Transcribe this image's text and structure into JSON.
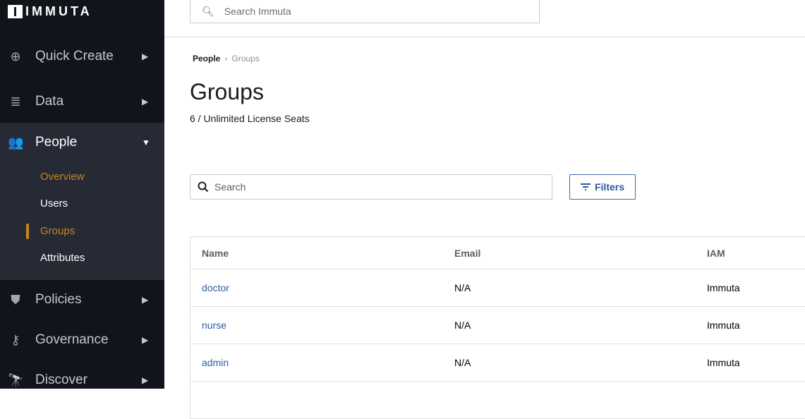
{
  "brand": "IMMUTA",
  "sidebar": {
    "items": [
      {
        "label": "Quick Create",
        "icon": "plus-circle-icon"
      },
      {
        "label": "Data",
        "icon": "database-icon"
      },
      {
        "label": "People",
        "icon": "users-icon"
      },
      {
        "label": "Policies",
        "icon": "shield-icon"
      },
      {
        "label": "Governance",
        "icon": "key-icon"
      },
      {
        "label": "Discover",
        "icon": "telescope-icon"
      }
    ],
    "people_sub": [
      "Overview",
      "Users",
      "Groups",
      "Attributes"
    ]
  },
  "topbar": {
    "search_placeholder": "Search Immuta"
  },
  "breadcrumb": {
    "parent": "People",
    "current": "Groups"
  },
  "page": {
    "title": "Groups",
    "seats": "6 / Unlimited License Seats",
    "search_placeholder": "Search",
    "filters_label": "Filters"
  },
  "table": {
    "headers": [
      "Name",
      "Email",
      "IAM"
    ],
    "rows": [
      [
        "doctor",
        "N/A",
        "Immuta"
      ],
      [
        "nurse",
        "N/A",
        "Immuta"
      ],
      [
        "admin",
        "N/A",
        "Immuta"
      ]
    ]
  },
  "colors": {
    "accent": "#c8841f",
    "link": "#2a5c9e",
    "sidebar": "#12141c"
  }
}
